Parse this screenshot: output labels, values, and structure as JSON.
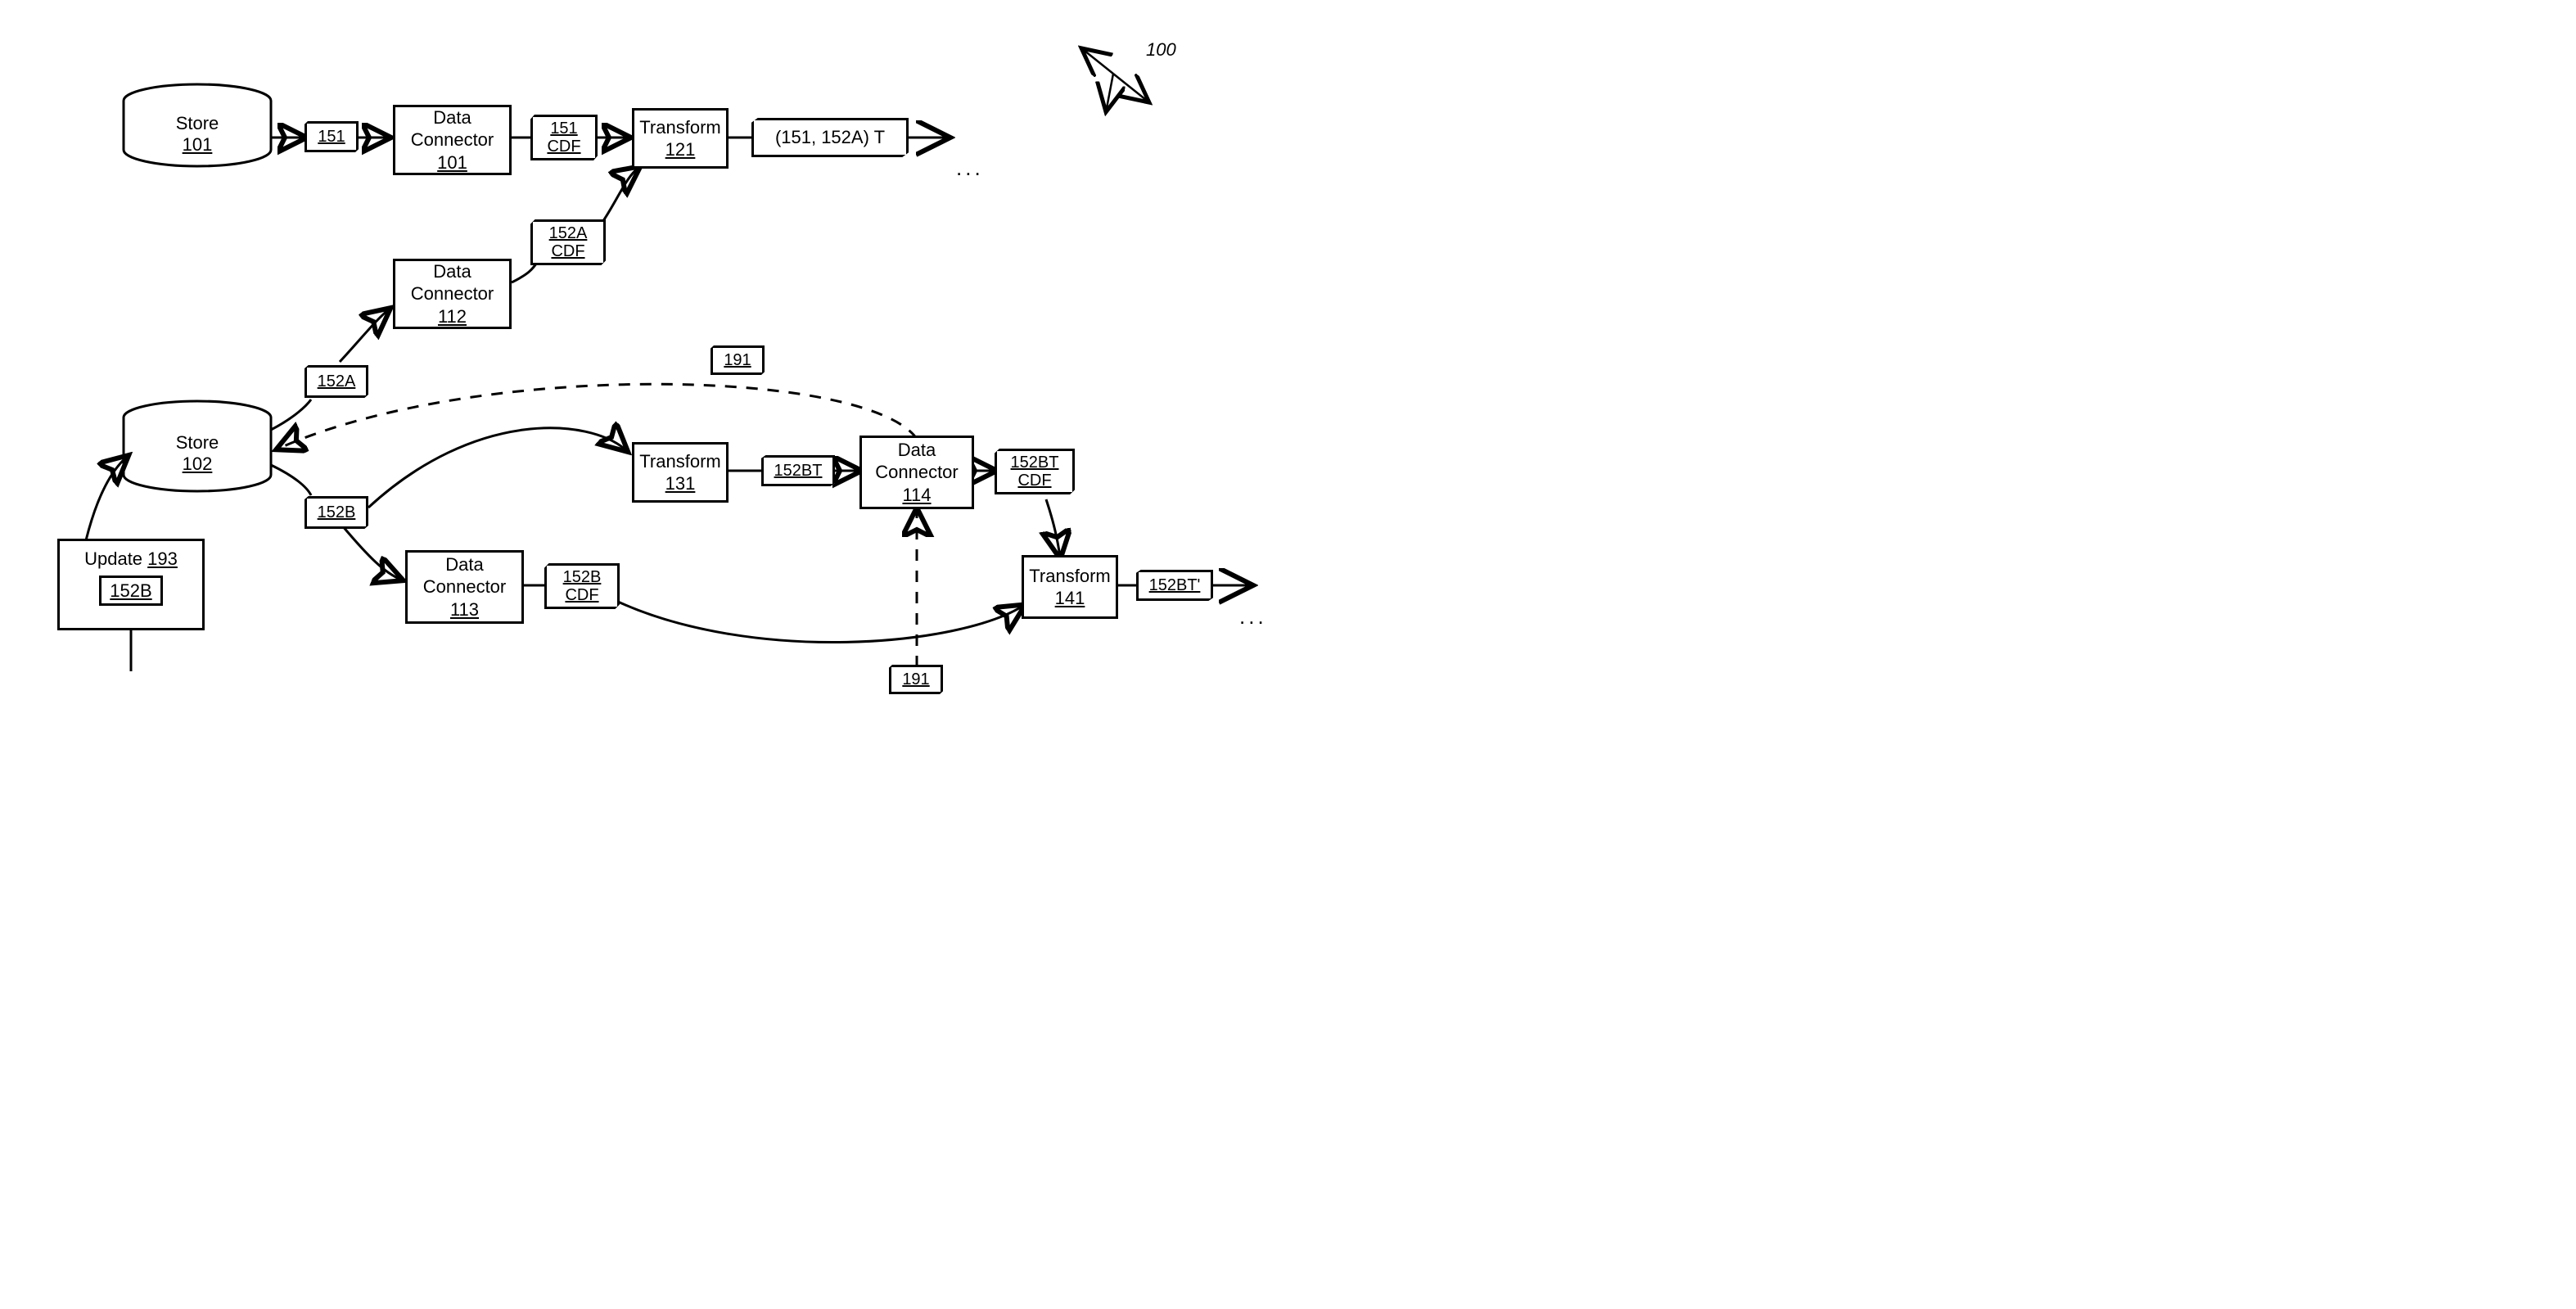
{
  "figureRef": "100",
  "stores": {
    "s1": {
      "label": "Store",
      "ref": "101"
    },
    "s2": {
      "label": "Store",
      "ref": "102"
    }
  },
  "connectors": {
    "c101": {
      "label": "Data Connector",
      "ref": "101"
    },
    "c112": {
      "label": "Data Connector",
      "ref": "112"
    },
    "c113": {
      "label": "Data Connector",
      "ref": "113"
    },
    "c114": {
      "label": "Data Connector",
      "ref": "114"
    }
  },
  "transforms": {
    "t121": {
      "label": "Transform",
      "ref": "121"
    },
    "t131": {
      "label": "Transform",
      "ref": "131"
    },
    "t141": {
      "label": "Transform",
      "ref": "141"
    }
  },
  "tags": {
    "t151": {
      "l1": "151"
    },
    "t151cdf": {
      "l1": "151",
      "l2": "CDF"
    },
    "t152a": {
      "l1": "152A"
    },
    "t152acdf": {
      "l1": "152A",
      "l2": "CDF"
    },
    "t152b": {
      "l1": "152B"
    },
    "t152bcdf": {
      "l1": "152B",
      "l2": "CDF"
    },
    "t152bt": {
      "l1": "152BT"
    },
    "t152btcdf": {
      "l1": "152BT",
      "l2": "CDF"
    },
    "t152btprime": {
      "l1": "152BT'"
    },
    "t191a": {
      "l1": "191"
    },
    "t191b": {
      "l1": "191"
    }
  },
  "ribbon": {
    "text": "(151, 152A) T"
  },
  "update": {
    "label": "Update",
    "ref": "193",
    "inner": "152B"
  },
  "dots": "..."
}
